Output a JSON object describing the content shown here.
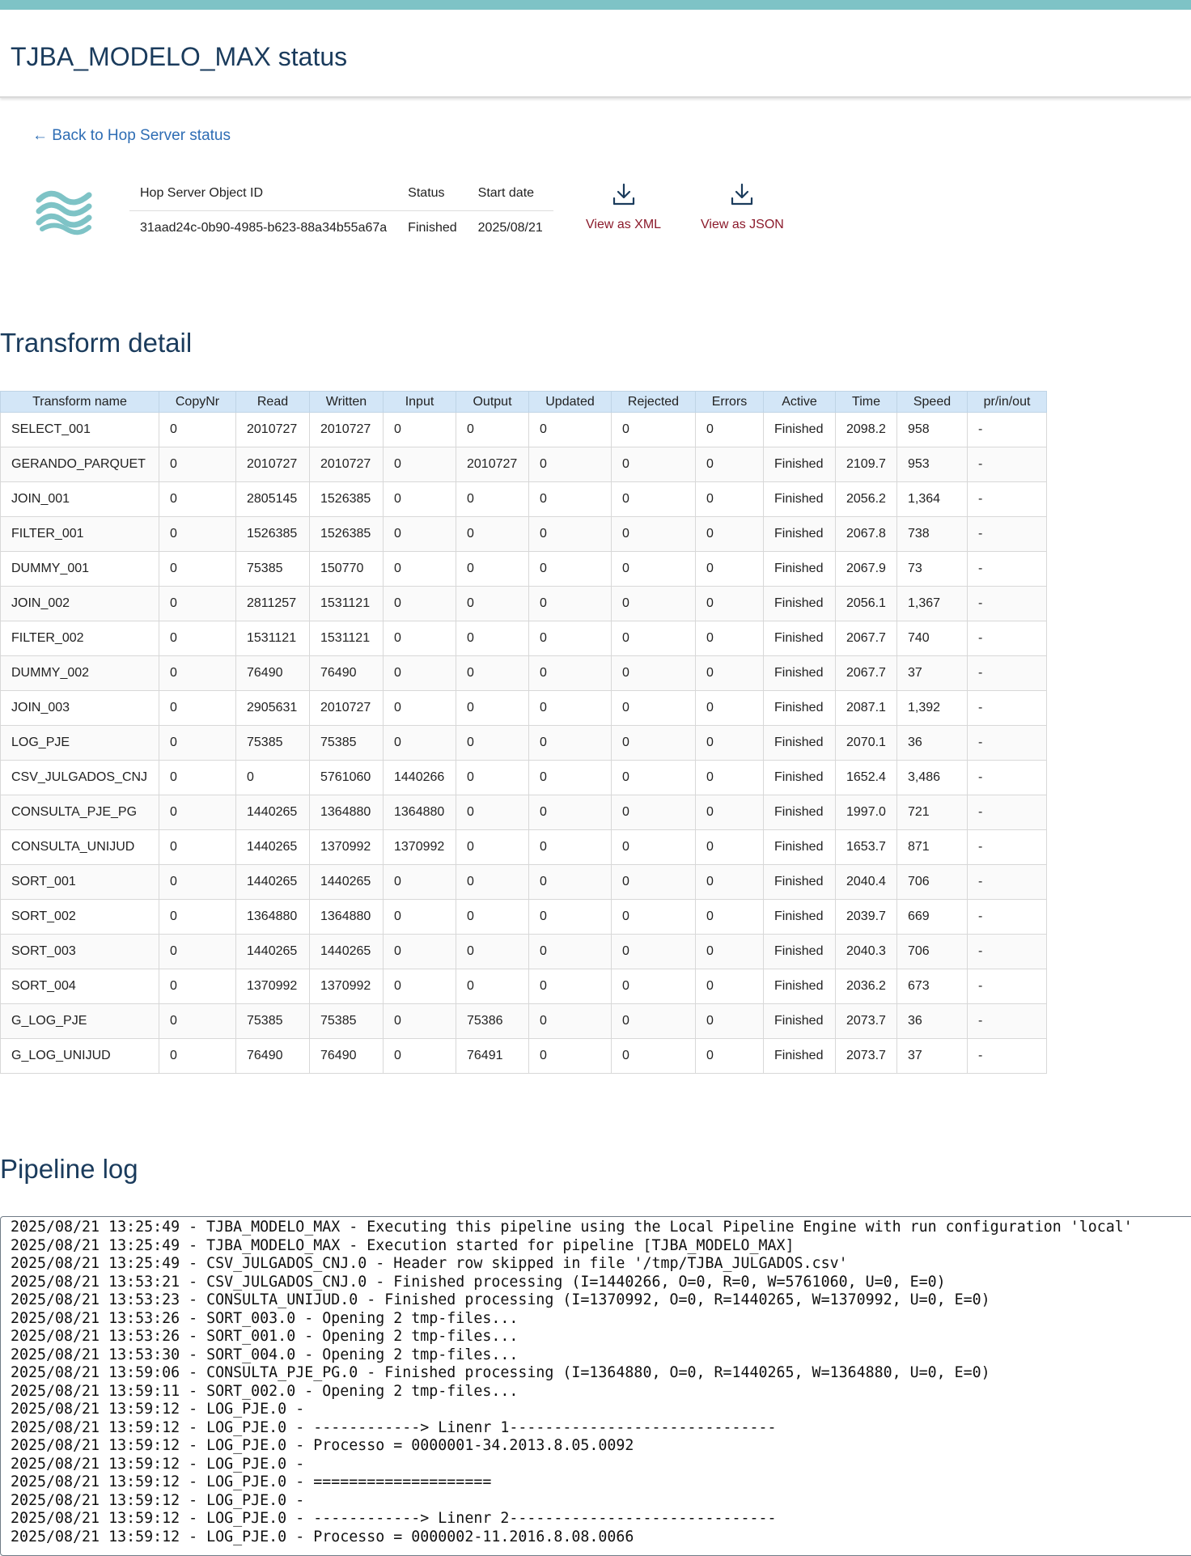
{
  "page": {
    "title": "TJBA_MODELO_MAX status",
    "back_link": "← Back to Hop Server status",
    "accent_color": "#7ec3c6"
  },
  "object_info": {
    "headers": [
      "Hop Server Object ID",
      "Status",
      "Start date"
    ],
    "values": [
      "31aad24c-0b90-4985-b623-88a34b55a67a",
      "Finished",
      "2025/08/21"
    ]
  },
  "downloads": {
    "xml_label": "View as XML",
    "json_label": "View as JSON",
    "icon": "download-icon"
  },
  "transform_detail": {
    "title": "Transform detail",
    "columns": [
      "Transform name",
      "CopyNr",
      "Read",
      "Written",
      "Input",
      "Output",
      "Updated",
      "Rejected",
      "Errors",
      "Active",
      "Time",
      "Speed",
      "pr/in/out"
    ],
    "rows": [
      [
        "SELECT_001",
        "0",
        "2010727",
        "2010727",
        "0",
        "0",
        "0",
        "0",
        "0",
        "Finished",
        "2098.2",
        "958",
        "-"
      ],
      [
        "GERANDO_PARQUET",
        "0",
        "2010727",
        "2010727",
        "0",
        "2010727",
        "0",
        "0",
        "0",
        "Finished",
        "2109.7",
        "953",
        "-"
      ],
      [
        "JOIN_001",
        "0",
        "2805145",
        "1526385",
        "0",
        "0",
        "0",
        "0",
        "0",
        "Finished",
        "2056.2",
        "1,364",
        "-"
      ],
      [
        "FILTER_001",
        "0",
        "1526385",
        "1526385",
        "0",
        "0",
        "0",
        "0",
        "0",
        "Finished",
        "2067.8",
        "738",
        "-"
      ],
      [
        "DUMMY_001",
        "0",
        "75385",
        "150770",
        "0",
        "0",
        "0",
        "0",
        "0",
        "Finished",
        "2067.9",
        "73",
        "-"
      ],
      [
        "JOIN_002",
        "0",
        "2811257",
        "1531121",
        "0",
        "0",
        "0",
        "0",
        "0",
        "Finished",
        "2056.1",
        "1,367",
        "-"
      ],
      [
        "FILTER_002",
        "0",
        "1531121",
        "1531121",
        "0",
        "0",
        "0",
        "0",
        "0",
        "Finished",
        "2067.7",
        "740",
        "-"
      ],
      [
        "DUMMY_002",
        "0",
        "76490",
        "76490",
        "0",
        "0",
        "0",
        "0",
        "0",
        "Finished",
        "2067.7",
        "37",
        "-"
      ],
      [
        "JOIN_003",
        "0",
        "2905631",
        "2010727",
        "0",
        "0",
        "0",
        "0",
        "0",
        "Finished",
        "2087.1",
        "1,392",
        "-"
      ],
      [
        "LOG_PJE",
        "0",
        "75385",
        "75385",
        "0",
        "0",
        "0",
        "0",
        "0",
        "Finished",
        "2070.1",
        "36",
        "-"
      ],
      [
        "CSV_JULGADOS_CNJ",
        "0",
        "0",
        "5761060",
        "1440266",
        "0",
        "0",
        "0",
        "0",
        "Finished",
        "1652.4",
        "3,486",
        "-"
      ],
      [
        "CONSULTA_PJE_PG",
        "0",
        "1440265",
        "1364880",
        "1364880",
        "0",
        "0",
        "0",
        "0",
        "Finished",
        "1997.0",
        "721",
        "-"
      ],
      [
        "CONSULTA_UNIJUD",
        "0",
        "1440265",
        "1370992",
        "1370992",
        "0",
        "0",
        "0",
        "0",
        "Finished",
        "1653.7",
        "871",
        "-"
      ],
      [
        "SORT_001",
        "0",
        "1440265",
        "1440265",
        "0",
        "0",
        "0",
        "0",
        "0",
        "Finished",
        "2040.4",
        "706",
        "-"
      ],
      [
        "SORT_002",
        "0",
        "1364880",
        "1364880",
        "0",
        "0",
        "0",
        "0",
        "0",
        "Finished",
        "2039.7",
        "669",
        "-"
      ],
      [
        "SORT_003",
        "0",
        "1440265",
        "1440265",
        "0",
        "0",
        "0",
        "0",
        "0",
        "Finished",
        "2040.3",
        "706",
        "-"
      ],
      [
        "SORT_004",
        "0",
        "1370992",
        "1370992",
        "0",
        "0",
        "0",
        "0",
        "0",
        "Finished",
        "2036.2",
        "673",
        "-"
      ],
      [
        "G_LOG_PJE",
        "0",
        "75385",
        "75385",
        "0",
        "75386",
        "0",
        "0",
        "0",
        "Finished",
        "2073.7",
        "36",
        "-"
      ],
      [
        "G_LOG_UNIJUD",
        "0",
        "76490",
        "76490",
        "0",
        "76491",
        "0",
        "0",
        "0",
        "Finished",
        "2073.7",
        "37",
        "-"
      ]
    ]
  },
  "pipeline_log": {
    "title": "Pipeline log",
    "lines": [
      "2025/08/21 13:25:49 - TJBA_MODELO_MAX - Executing this pipeline using the Local Pipeline Engine with run configuration 'local'",
      "2025/08/21 13:25:49 - TJBA_MODELO_MAX - Execution started for pipeline [TJBA_MODELO_MAX]",
      "2025/08/21 13:25:49 - CSV_JULGADOS_CNJ.0 - Header row skipped in file '/tmp/TJBA_JULGADOS.csv'",
      "2025/08/21 13:53:21 - CSV_JULGADOS_CNJ.0 - Finished processing (I=1440266, O=0, R=0, W=5761060, U=0, E=0)",
      "2025/08/21 13:53:23 - CONSULTA_UNIJUD.0 - Finished processing (I=1370992, O=0, R=1440265, W=1370992, U=0, E=0)",
      "2025/08/21 13:53:26 - SORT_003.0 - Opening 2 tmp-files...",
      "2025/08/21 13:53:26 - SORT_001.0 - Opening 2 tmp-files...",
      "2025/08/21 13:53:30 - SORT_004.0 - Opening 2 tmp-files...",
      "2025/08/21 13:59:06 - CONSULTA_PJE_PG.0 - Finished processing (I=1364880, O=0, R=1440265, W=1364880, U=0, E=0)",
      "2025/08/21 13:59:11 - SORT_002.0 - Opening 2 tmp-files...",
      "2025/08/21 13:59:12 - LOG_PJE.0 - ",
      "2025/08/21 13:59:12 - LOG_PJE.0 - ------------> Linenr 1------------------------------",
      "2025/08/21 13:59:12 - LOG_PJE.0 - Processo = 0000001-34.2013.8.05.0092",
      "2025/08/21 13:59:12 - LOG_PJE.0 - ",
      "2025/08/21 13:59:12 - LOG_PJE.0 - ====================",
      "2025/08/21 13:59:12 - LOG_PJE.0 - ",
      "2025/08/21 13:59:12 - LOG_PJE.0 - ------------> Linenr 2------------------------------",
      "2025/08/21 13:59:12 - LOG_PJE.0 - Processo = 0000002-11.2016.8.08.0066"
    ]
  }
}
